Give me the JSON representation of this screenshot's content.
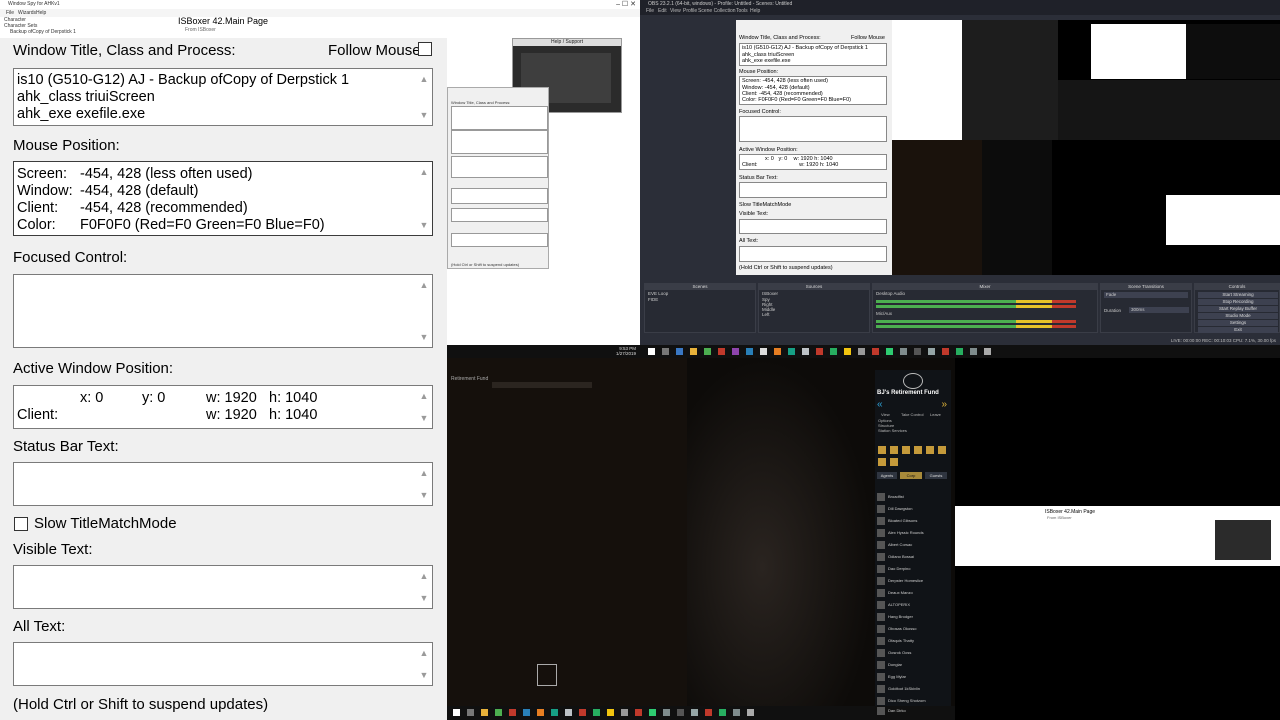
{
  "left_window": {
    "title": "Window Spy for AHKv1",
    "menu": [
      "File",
      "Wizards",
      "Help"
    ],
    "tree": [
      "Character",
      "Character Sets",
      "Backup ofCopy of Derpstick 1"
    ],
    "main_page_title": "ISBoxer 42.Main Page",
    "main_page_subtitle": "From ISBoxer"
  },
  "window_spy": {
    "title_section": "Window Title, Class and Process:",
    "follow_mouse": "Follow Mouse",
    "title_lines": [
      "is10 (G510-G12) AJ - Backup ofCopy of Derpstick 1",
      "ahk_class triuiScreen",
      "ahk_exe exefile.exe"
    ],
    "mouse_section": "Mouse Position:",
    "mouse_rows": [
      {
        "k": "Screen:",
        "v": "-454, 428 (less often used)"
      },
      {
        "k": "Window:",
        "v": "-454, 428 (default)"
      },
      {
        "k": "Client:",
        "v": "-454, 428 (recommended)"
      },
      {
        "k": "Color:",
        "v": "F0F0F0 (Red=F0 Green=F0 Blue=F0)"
      }
    ],
    "focused_section": "Focused Control:",
    "active_section": "Active Window Position:",
    "active_row1": {
      "x": "x: 0",
      "y": "y: 0",
      "w": "w: 1920",
      "h": "h: 1040"
    },
    "active_row2": {
      "label": "Client:",
      "w": "w: 1920",
      "h": "h: 1040"
    },
    "status_section": "Status Bar Text:",
    "slow_title": "Slow TitleMatchMode",
    "visible_section": "Visible Text:",
    "all_section": "All Text:",
    "footer": "(Hold Ctrl or Shift to suspend updates)"
  },
  "help_window": {
    "title": "Help / Support"
  },
  "obs": {
    "title": "OBS 23.2.1 (64-bit, windows) - Profile: Untitled - Scenes: Untitled",
    "menu": [
      "File",
      "Edit",
      "View",
      "Profile",
      "Scene Collection",
      "Tools",
      "Help"
    ],
    "docks": [
      "Scenes",
      "Sources",
      "Mixer",
      "Scene Transitions",
      "Controls"
    ],
    "scenes": [
      "EVE Loop",
      "FIDE"
    ],
    "sources": [
      "ISBoxer",
      "Spy",
      "Right",
      "Middle",
      "Left"
    ],
    "mixer": [
      "Desktop Audio",
      "Mic/Aux"
    ],
    "transition": "Fade",
    "duration_label": "Duration",
    "duration": "300ms",
    "controls": [
      "Start Streaming",
      "Stop Recording",
      "Start Replay Buffer",
      "Studio Mode",
      "Settings",
      "Exit"
    ],
    "status": "LIVE: 00:00:00   REC: 00:10:03   CPU: 7.1%, 30.00 fps"
  },
  "taskbar": {
    "time": "9:53 PM",
    "date": "1/27/2019"
  },
  "game": {
    "window_title": "Retirement Fund",
    "corp_name": "BJ's Retirement Fund",
    "tabs": [
      "View",
      "Take Control",
      "Leave"
    ],
    "tab_sub": [
      "Options",
      "Structure",
      "Station Services"
    ],
    "buttons": [
      "Agents",
      "Corp",
      "Guests"
    ],
    "characters": [
      "Broadfist",
      "Dill Dawgston",
      "Bloated Gibsons",
      "Alex Hyssic Rounds",
      "Albert Corsac",
      "Odiano Bossai",
      "Dao Derpino",
      "Derpster Homeslice",
      "Deaux Manzo",
      "ALTOPERIX",
      "Hang Brodger",
      "Obosas Okosso",
      "Ofaquis Thatty",
      "Oosrok Ooss",
      "Dongiar",
      "Egg Mylar",
      "Goldfoot 1kSkivlin",
      "Dico Sheng Shotzom",
      "Dan Dirko"
    ]
  },
  "bottom_right": {
    "doc_title": "ISBoxer 42.Main Page",
    "doc_sub": "From ISBoxer"
  }
}
